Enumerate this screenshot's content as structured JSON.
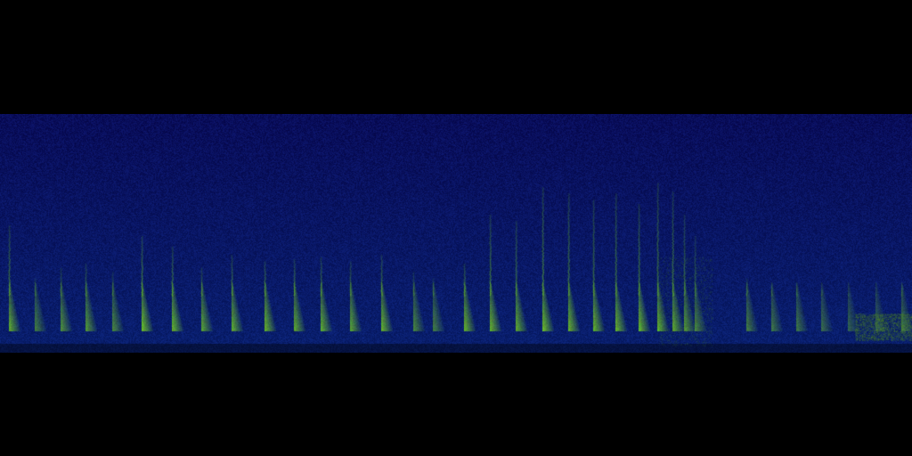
{
  "colors": {
    "background": "#000000",
    "noise_floor": "#0a0a5a",
    "signal": "#7ad81c",
    "signal_peak": "#a6ff2a"
  },
  "spectrogram": {
    "calls": [
      {
        "t": 0.01,
        "intensity": 0.8,
        "reach": 0.5
      },
      {
        "t": 0.038,
        "intensity": 0.55,
        "reach": 0.25
      },
      {
        "t": 0.066,
        "intensity": 0.65,
        "reach": 0.3
      },
      {
        "t": 0.094,
        "intensity": 0.7,
        "reach": 0.32
      },
      {
        "t": 0.123,
        "intensity": 0.6,
        "reach": 0.28
      },
      {
        "t": 0.155,
        "intensity": 0.9,
        "reach": 0.45
      },
      {
        "t": 0.188,
        "intensity": 0.85,
        "reach": 0.4
      },
      {
        "t": 0.221,
        "intensity": 0.75,
        "reach": 0.3
      },
      {
        "t": 0.254,
        "intensity": 0.8,
        "reach": 0.36
      },
      {
        "t": 0.29,
        "intensity": 0.85,
        "reach": 0.33
      },
      {
        "t": 0.322,
        "intensity": 0.8,
        "reach": 0.34
      },
      {
        "t": 0.352,
        "intensity": 0.8,
        "reach": 0.35
      },
      {
        "t": 0.384,
        "intensity": 0.75,
        "reach": 0.33
      },
      {
        "t": 0.418,
        "intensity": 0.85,
        "reach": 0.36
      },
      {
        "t": 0.453,
        "intensity": 0.6,
        "reach": 0.28
      },
      {
        "t": 0.475,
        "intensity": 0.55,
        "reach": 0.25
      },
      {
        "t": 0.509,
        "intensity": 0.85,
        "reach": 0.32
      },
      {
        "t": 0.537,
        "intensity": 0.85,
        "reach": 0.55
      },
      {
        "t": 0.565,
        "intensity": 0.8,
        "reach": 0.52
      },
      {
        "t": 0.595,
        "intensity": 0.9,
        "reach": 0.68
      },
      {
        "t": 0.623,
        "intensity": 0.85,
        "reach": 0.65
      },
      {
        "t": 0.65,
        "intensity": 0.85,
        "reach": 0.62
      },
      {
        "t": 0.675,
        "intensity": 0.85,
        "reach": 0.65
      },
      {
        "t": 0.7,
        "intensity": 0.85,
        "reach": 0.6
      },
      {
        "t": 0.721,
        "intensity": 0.85,
        "reach": 0.7
      },
      {
        "t": 0.737,
        "intensity": 0.8,
        "reach": 0.66
      },
      {
        "t": 0.75,
        "intensity": 0.7,
        "reach": 0.55
      },
      {
        "t": 0.762,
        "intensity": 0.6,
        "reach": 0.45
      },
      {
        "t": 0.818,
        "intensity": 0.55,
        "reach": 0.25
      },
      {
        "t": 0.846,
        "intensity": 0.5,
        "reach": 0.22
      },
      {
        "t": 0.873,
        "intensity": 0.5,
        "reach": 0.22
      },
      {
        "t": 0.9,
        "intensity": 0.45,
        "reach": 0.2
      },
      {
        "t": 0.93,
        "intensity": 0.4,
        "reach": 0.18
      },
      {
        "t": 0.96,
        "intensity": 0.4,
        "reach": 0.18
      },
      {
        "t": 0.988,
        "intensity": 0.5,
        "reach": 0.22
      }
    ]
  }
}
